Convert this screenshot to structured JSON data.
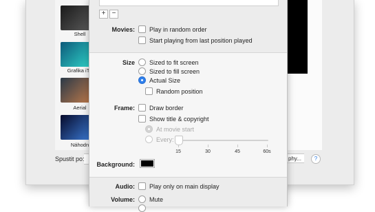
{
  "thumbnails": [
    {
      "label": "Shell",
      "colors": [
        "#1a1a1a",
        "#5a5a5a"
      ]
    },
    {
      "label": "Grafika iTu",
      "colors": [
        "#0d5a7a",
        "#2fd3c8"
      ]
    },
    {
      "label": "Aerial",
      "colors": [
        "#2a3948",
        "#c07a4a"
      ]
    },
    {
      "label": "Náhodn",
      "colors": [
        "#060a2a",
        "#3b7bd6"
      ]
    }
  ],
  "bottom_bar": {
    "start_label": "Spustit po:",
    "right_button_text": "phy...",
    "help_text": "?"
  },
  "sheet": {
    "list_buttons": {
      "add": "+",
      "remove": "−"
    },
    "movies": {
      "label": "Movies:",
      "play_random": "Play in random order",
      "start_last": "Start playing from last position played"
    },
    "size": {
      "label": "Size",
      "options": [
        "Sized to fit screen",
        "Sized to fill screen",
        "Actual Size"
      ],
      "selected": "Actual Size",
      "random_position": "Random position"
    },
    "frame": {
      "label": "Frame:",
      "draw_border": "Draw border",
      "show_title": "Show title & copyright",
      "at_movie_start": "At movie start",
      "every": "Every:",
      "slider_ticks": [
        "15",
        "30",
        "45",
        "60s"
      ],
      "slider_value": "15"
    },
    "background": {
      "label": "Background:",
      "color": "#000000"
    },
    "audio": {
      "label": "Audio:",
      "play_main": "Play only on main display"
    },
    "volume": {
      "label": "Volume:",
      "mute": "Mute"
    }
  }
}
